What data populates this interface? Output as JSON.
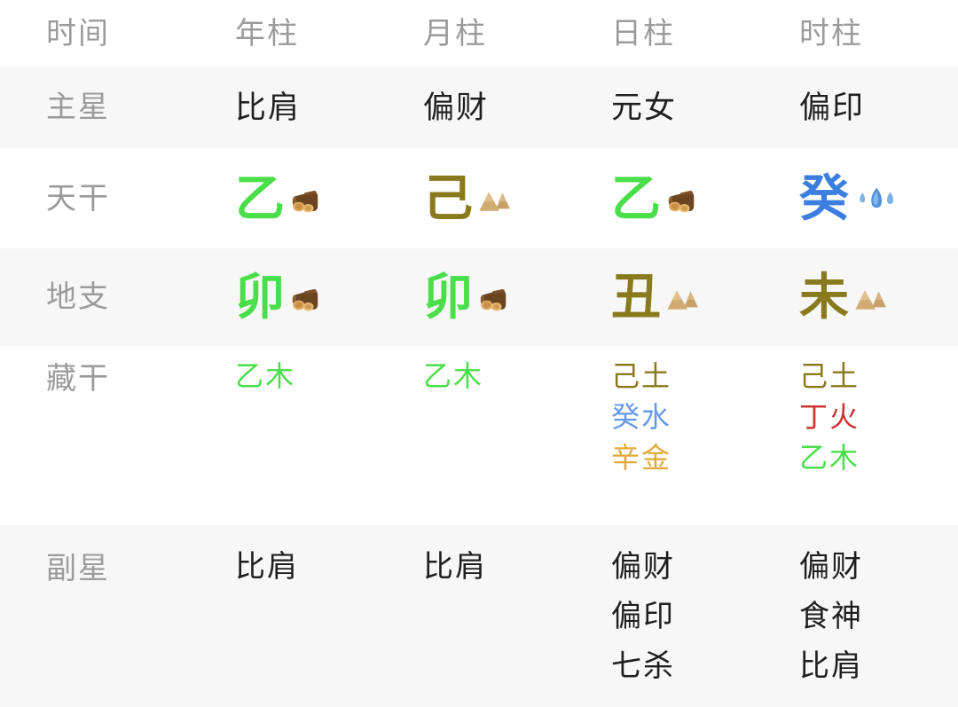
{
  "table": {
    "header": {
      "label": "时间",
      "pillars": [
        "年柱",
        "月柱",
        "日柱",
        "时柱"
      ]
    },
    "rows": [
      {
        "key": "main_star",
        "label": "主星",
        "shaded": true,
        "cells": [
          "比肩",
          "偏财",
          "元女",
          "偏印"
        ]
      },
      {
        "key": "heavenly_stem",
        "label": "天干",
        "shaded": false,
        "cells": [
          {
            "char": "乙",
            "color": "#4ade4a",
            "element": "wood",
            "icon": "wood-log-icon"
          },
          {
            "char": "己",
            "color": "#8a7a1e",
            "element": "earth",
            "icon": "mountain-icon"
          },
          {
            "char": "乙",
            "color": "#4ade4a",
            "element": "wood",
            "icon": "wood-log-icon"
          },
          {
            "char": "癸",
            "color": "#3b7ee0",
            "element": "water",
            "icon": "water-drop-icon"
          }
        ]
      },
      {
        "key": "earthly_branch",
        "label": "地支",
        "shaded": true,
        "cells": [
          {
            "char": "卯",
            "color": "#4ade4a",
            "element": "wood",
            "icon": "wood-log-icon"
          },
          {
            "char": "卯",
            "color": "#4ade4a",
            "element": "wood",
            "icon": "wood-log-icon"
          },
          {
            "char": "丑",
            "color": "#8a7a1e",
            "element": "earth",
            "icon": "mountain-icon"
          },
          {
            "char": "未",
            "color": "#8a7a1e",
            "element": "earth",
            "icon": "mountain-icon"
          }
        ]
      },
      {
        "key": "hidden_stems",
        "label": "藏干",
        "shaded": false,
        "cells": [
          [
            {
              "text": "乙木",
              "color": "#4ade4a"
            }
          ],
          [
            {
              "text": "乙木",
              "color": "#4ade4a"
            }
          ],
          [
            {
              "text": "己土",
              "color": "#8a7a1e"
            },
            {
              "text": "癸水",
              "color": "#6699e8"
            },
            {
              "text": "辛金",
              "color": "#e0a93b"
            }
          ],
          [
            {
              "text": "己土",
              "color": "#8a7a1e"
            },
            {
              "text": "丁火",
              "color": "#cc3333"
            },
            {
              "text": "乙木",
              "color": "#4ade4a"
            }
          ]
        ]
      },
      {
        "key": "sub_star",
        "label": "副星",
        "shaded": true,
        "cells": [
          [
            "比肩"
          ],
          [
            "比肩"
          ],
          [
            "偏财",
            "偏印",
            "七杀"
          ],
          [
            "偏财",
            "食神",
            "比肩"
          ]
        ]
      }
    ]
  },
  "colors": {
    "wood": "#4ade4a",
    "earth": "#8a7a1e",
    "water": "#3b7ee0",
    "fire": "#cc3333",
    "metal": "#e0a93b",
    "label_gray": "#9b9b9b",
    "text_dark": "#1f1f1f",
    "row_shaded": "#f7f7f7",
    "row_plain": "#ffffff"
  }
}
